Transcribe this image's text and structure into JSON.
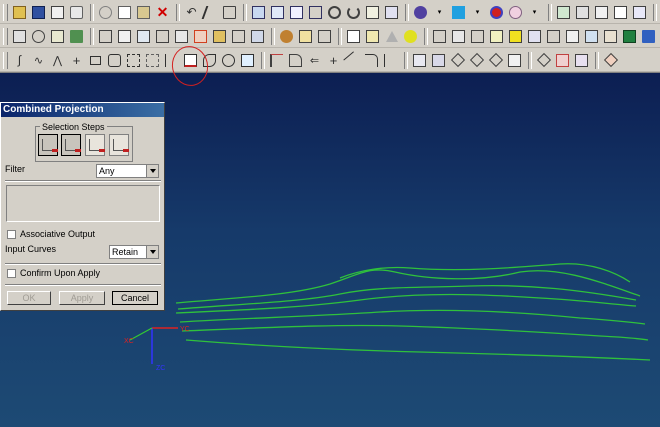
{
  "dialog": {
    "title": "Combined Projection",
    "selection_steps_label": "Selection Steps",
    "filter_label": "Filter",
    "filter_value": "Any",
    "associative_output_label": "Associative Output",
    "associative_output_checked": false,
    "input_curves_label": "Input Curves",
    "input_curves_value": "Retain",
    "confirm_upon_apply_label": "Confirm Upon Apply",
    "confirm_upon_apply_checked": false,
    "ok_label": "OK",
    "apply_label": "Apply",
    "cancel_label": "Cancel"
  },
  "colors": {
    "curve": "#2fc13c",
    "annotation_circle": "#d42020",
    "titlebar": "#0a246a"
  },
  "toolbar": {
    "rows": 3,
    "highlighted_icon": "combined-projection-icon"
  }
}
